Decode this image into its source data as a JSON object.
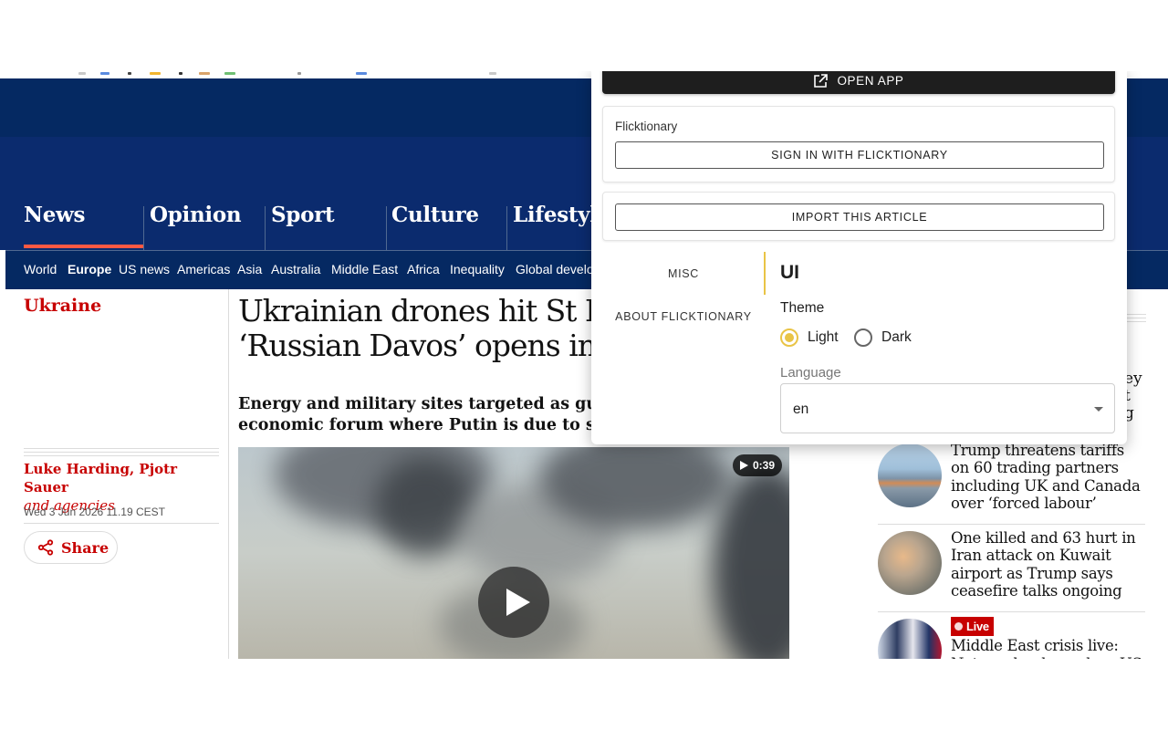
{
  "site": {
    "pillars": [
      "News",
      "Opinion",
      "Sport",
      "Culture",
      "Lifestyl"
    ],
    "subnav": [
      "World",
      "Europe",
      "US news",
      "Americas",
      "Asia",
      "Australia",
      "Middle East",
      "Africa",
      "Inequality",
      "Global develo"
    ],
    "subnav_active": "Europe"
  },
  "article": {
    "section": "Ukraine",
    "headline_line1": "Ukrainian drones hit St Pe",
    "headline_line2": "‘Russian Davos’ opens in c",
    "standfirst_line1": "Energy and military sites targeted as guests g",
    "standfirst_line2": "economic forum where Putin is due to speak",
    "byline_names": "Luke Harding, Pjotr Sauer",
    "byline_agencies": "and agencies",
    "dateline": "Wed 3 Jun 2026 11.19 CEST",
    "share_label": "Share",
    "video_duration": "0:39"
  },
  "right_column": {
    "fragment_lines": [
      "ey",
      "t",
      "g"
    ],
    "items": [
      {
        "title": "Trump threatens tariffs on 60 trading partners including UK and Canada over ‘forced labour’",
        "thumb": "port"
      },
      {
        "title": "One killed and 63 hurt in Iran attack on Kuwait airport as Trump says ceasefire talks ongoing",
        "thumb": "explosion"
      },
      {
        "badge": "Live",
        "title": "Middle East crisis live: Netanyahu downplays US",
        "thumb": "leaders"
      }
    ]
  },
  "popup": {
    "open_app_label": "OPEN APP",
    "account_card_title": "Flicktionary",
    "sign_in_label": "SIGN IN WITH FLICKTIONARY",
    "import_label": "IMPORT THIS ARTICLE",
    "tabs": [
      "MISC",
      "ABOUT FLICKTIONARY"
    ],
    "active_tab": "MISC",
    "section_heading": "UI",
    "theme_label": "Theme",
    "theme_options": [
      "Light",
      "Dark"
    ],
    "theme_selected": "Light",
    "language_label": "Language",
    "language_value": "en"
  },
  "colors": {
    "guardian_blue": "#052962",
    "guardian_red": "#c70000",
    "accent_yellow": "#e9c446",
    "pillar_underline": "#ff5943"
  }
}
